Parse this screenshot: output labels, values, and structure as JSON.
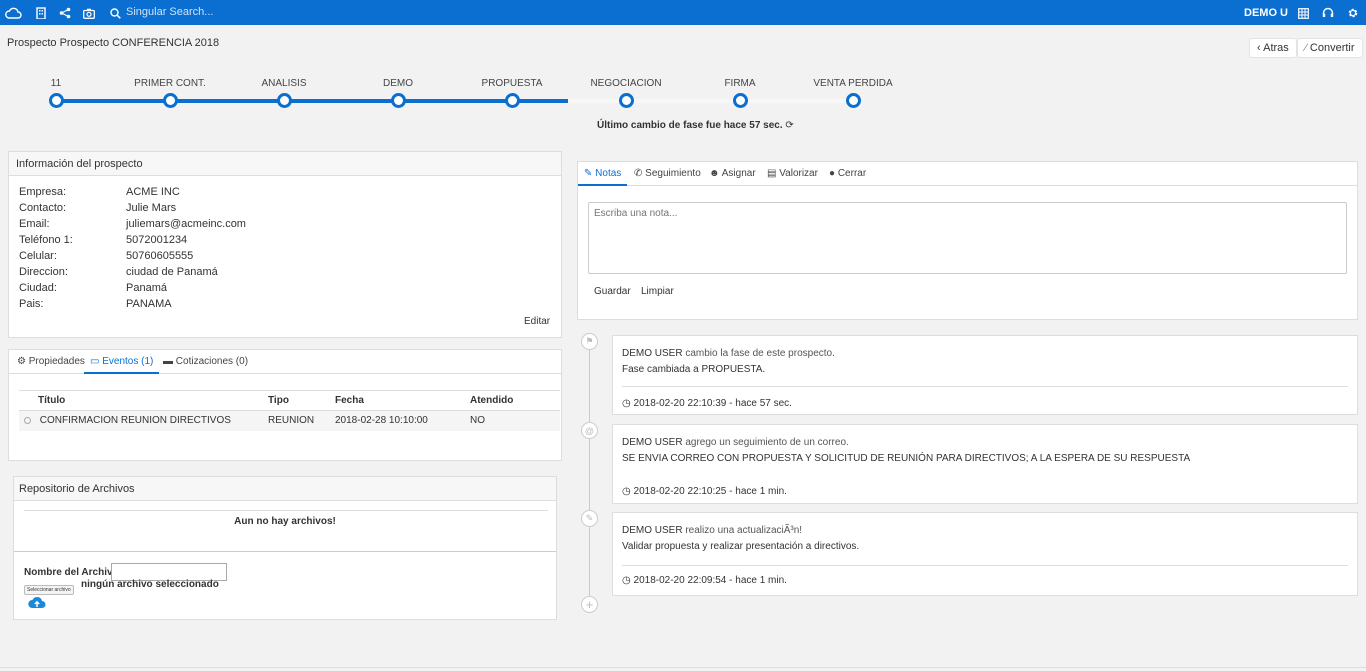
{
  "topbar": {
    "search_placeholder": "Singular Search...",
    "user": "DEMO U",
    "icons": [
      "cloud-icon",
      "building-icon",
      "share-icon",
      "camera-icon",
      "search-icon",
      "grid-icon",
      "headset-icon",
      "gear-icon"
    ]
  },
  "page": {
    "title": "Prospecto Prospecto CONFERENCIA 2018",
    "back_label": "Atras",
    "convert_label": "Convertir"
  },
  "stages": {
    "items": [
      "11",
      "PRIMER CONT.",
      "ANALISIS",
      "DEMO",
      "PROPUESTA",
      "NEGOCIACION",
      "FIRMA",
      "VENTA PERDIDA"
    ],
    "current_index": 4,
    "phase_change_text": "Último cambio de fase fue hace 57 sec."
  },
  "prospect_info": {
    "title": "Información del prospecto",
    "fields": [
      {
        "label": "Empresa:",
        "value": "ACME INC"
      },
      {
        "label": "Contacto:",
        "value": "Julie Mars"
      },
      {
        "label": "Email:",
        "value": "juliemars@acmeinc.com"
      },
      {
        "label": "Teléfono 1:",
        "value": "5072001234"
      },
      {
        "label": "Celular:",
        "value": "50760605555"
      },
      {
        "label": "Direccion:",
        "value": "ciudad de Panamá"
      },
      {
        "label": "Ciudad:",
        "value": "Panamá"
      },
      {
        "label": "Pais:",
        "value": "PANAMA"
      }
    ],
    "edit_label": "Editar"
  },
  "events_panel": {
    "tabs": [
      "Propiedades",
      "Eventos (1)",
      "Cotizaciones (0)"
    ],
    "active_tab": "Eventos (1)",
    "columns": [
      "Título",
      "Tipo",
      "Fecha",
      "Atendido"
    ],
    "rows": [
      {
        "titulo": "CONFIRMACION REUNION DIRECTIVOS",
        "tipo": "REUNION",
        "fecha": "2018-02-28 10:10:00",
        "atendido": "NO"
      }
    ]
  },
  "files": {
    "title": "Repositorio de Archivos",
    "empty_text": "Aun no hay archivos!",
    "name_label": "Nombre del Archivo:",
    "select_button": "Seleccionar archivo",
    "no_file_text": "ningún archivo seleccionado"
  },
  "notes": {
    "tabs": [
      "Notas",
      "Seguimiento",
      "Asignar",
      "Valorizar",
      "Cerrar"
    ],
    "active_tab": "Notas",
    "placeholder": "Escriba una nota...",
    "save_label": "Guardar",
    "clear_label": "Limpiar"
  },
  "timeline": [
    {
      "user": "DEMO USER",
      "action": "cambio la fase de este prospecto.",
      "detail": "Fase cambiada a PROPUESTA.",
      "time": "2018-02-20 22:10:39 - hace 57 sec.",
      "icon": "flag-icon"
    },
    {
      "user": "DEMO USER",
      "action": "agrego un seguimiento de un correo.",
      "detail": "SE ENVIA CORREO CON PROPUESTA Y SOLICITUD DE REUNIÓN PARA DIRECTIVOS; A LA ESPERA DE SU RESPUESTA",
      "time": "2018-02-20 22:10:25 - hace 1 min.",
      "icon": "at-icon"
    },
    {
      "user": "DEMO USER",
      "action": "realizo una actualizaciÃ³n!",
      "detail": "Validar propuesta y realizar presentación a directivos.",
      "time": "2018-02-20 22:09:54 - hace 1 min.",
      "icon": "edit-icon"
    }
  ],
  "colors": {
    "accent": "#0a6fd1",
    "topbar": "#0a6fd1"
  }
}
